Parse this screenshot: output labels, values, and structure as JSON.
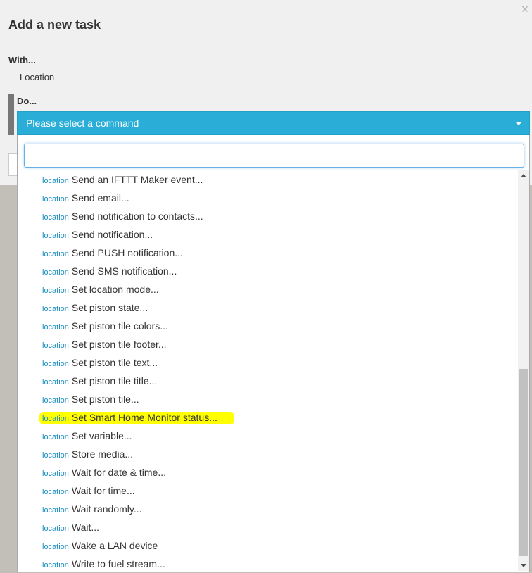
{
  "dialog": {
    "title": "Add a new task",
    "with_label": "With...",
    "with_value": "Location",
    "do_label": "Do...",
    "select_placeholder": "Please select a command",
    "search_value": ""
  },
  "commands": {
    "tag": "location",
    "items": [
      "Send an IFTTT Maker event...",
      "Send email...",
      "Send notification to contacts...",
      "Send notification...",
      "Send PUSH notification...",
      "Send SMS notification...",
      "Set location mode...",
      "Set piston state...",
      "Set piston tile colors...",
      "Set piston tile footer...",
      "Set piston tile text...",
      "Set piston tile title...",
      "Set piston tile...",
      "Set Smart Home Monitor status...",
      "Set variable...",
      "Store media...",
      "Wait for date & time...",
      "Wait for time...",
      "Wait randomly...",
      "Wait...",
      "Wake a LAN device",
      "Write to fuel stream..."
    ],
    "highlighted_item": "Set Smart Home Monitor status...",
    "highlight_color": "#ffff00"
  },
  "colors": {
    "accent": "#2aaed8",
    "tag": "#1a8fc0"
  },
  "icons": {
    "close": "close-icon",
    "caret": "chevron-down-icon"
  }
}
